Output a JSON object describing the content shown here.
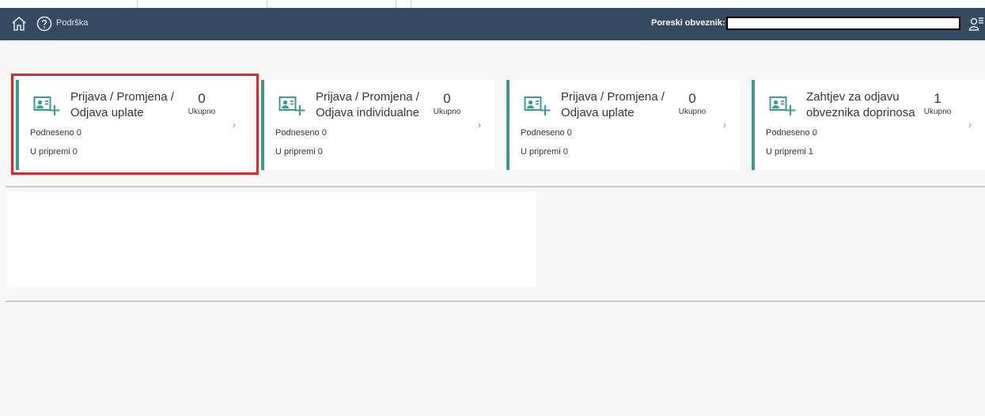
{
  "shell": {
    "help_label": "Podrška",
    "taxpayer_label": "Poreski obveznik:",
    "taxpayer_value": ""
  },
  "icons": {
    "home": "home-icon",
    "help": "help-circle-icon",
    "user": "user-list-icon",
    "tile": "person-card-add-icon",
    "chevron": "chevron-right-icon"
  },
  "colors": {
    "shellbar": "#354a5f",
    "accent": "#3a9b8e",
    "highlight": "#d62b2b"
  },
  "tiles": [
    {
      "title": "Prijava / Promjena / Odjava uplate",
      "count": "0",
      "count_label": "Ukupno",
      "submitted": "Podneseno 0",
      "in_prep": "U pripremi 0",
      "highlighted": true
    },
    {
      "title": "Prijava / Promjena / Odjava individualne",
      "count": "0",
      "count_label": "Ukupno",
      "submitted": "Podneseno 0",
      "in_prep": "U pripremi 0",
      "highlighted": false
    },
    {
      "title": "Prijava / Promjena / Odjava uplate",
      "count": "0",
      "count_label": "Ukupno",
      "submitted": "Podneseno 0",
      "in_prep": "U pripremi 0",
      "highlighted": false
    },
    {
      "title": "Zahtjev za odjavu obveznika doprinosa",
      "count": "1",
      "count_label": "Ukupno",
      "submitted": "Podneseno 0",
      "in_prep": "U pripremi 1",
      "highlighted": false
    }
  ]
}
